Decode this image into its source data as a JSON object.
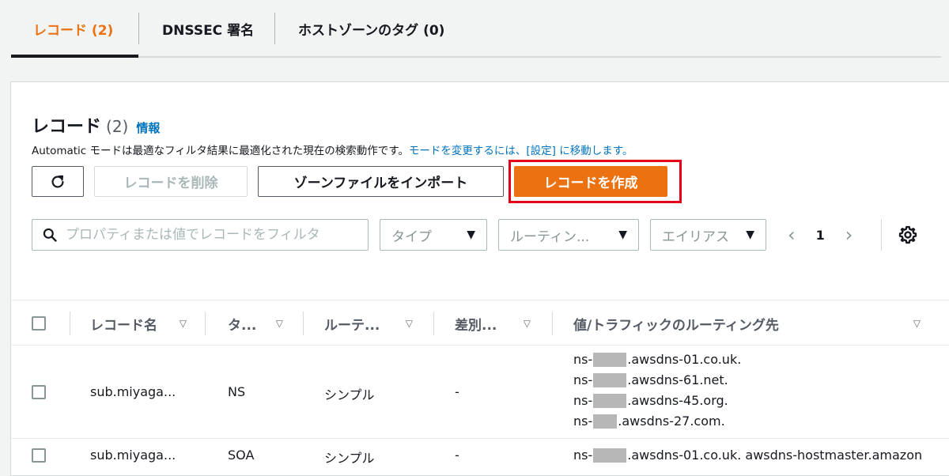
{
  "tabs": [
    {
      "label": "レコード (2)",
      "active": true
    },
    {
      "label": "DNSSEC 署名",
      "active": false
    },
    {
      "label": "ホストゾーンのタグ (0)",
      "active": false
    }
  ],
  "header": {
    "title": "レコード",
    "count": "(2)",
    "info": "情報",
    "desc_text": "Automatic モードは最適なフィルタ結果に最適化された現在の検索動作です。",
    "desc_link": "モードを変更するには、[設定] に移動します。"
  },
  "toolbar": {
    "refresh_icon": "refresh-icon",
    "delete_label": "レコードを削除",
    "import_label": "ゾーンファイルをインポート",
    "create_label": "レコードを作成"
  },
  "filters": {
    "search_placeholder": "プロパティまたは値でレコードをフィルタ",
    "type_label": "タイプ",
    "routing_label": "ルーティン...",
    "alias_label": "エイリアス"
  },
  "pagination": {
    "page": "1"
  },
  "table": {
    "columns": [
      "レコード名",
      "タ...",
      "ルーテ...",
      "差別...",
      "値/トラフィックのルーティング先"
    ],
    "rows": [
      {
        "name": "sub.miyaga...",
        "type": "NS",
        "routing": "シンプル",
        "diff": "-",
        "values": [
          {
            "prefix": "ns-",
            "suffix": ".awsdns-01.co.uk."
          },
          {
            "prefix": "ns-",
            "suffix": ".awsdns-61.net."
          },
          {
            "prefix": "ns-",
            "suffix": ".awsdns-45.org."
          },
          {
            "prefix": "ns-",
            "suffix": ".awsdns-27.com."
          }
        ]
      },
      {
        "name": "sub.miyaga...",
        "type": "SOA",
        "routing": "シンプル",
        "diff": "-",
        "values": [
          {
            "prefix": "ns-",
            "suffix": ".awsdns-01.co.uk. awsdns-hostmaster.amazon"
          }
        ]
      }
    ]
  },
  "colors": {
    "accent": "#ec7211",
    "link": "#0073bb",
    "highlight": "#e4001b"
  }
}
